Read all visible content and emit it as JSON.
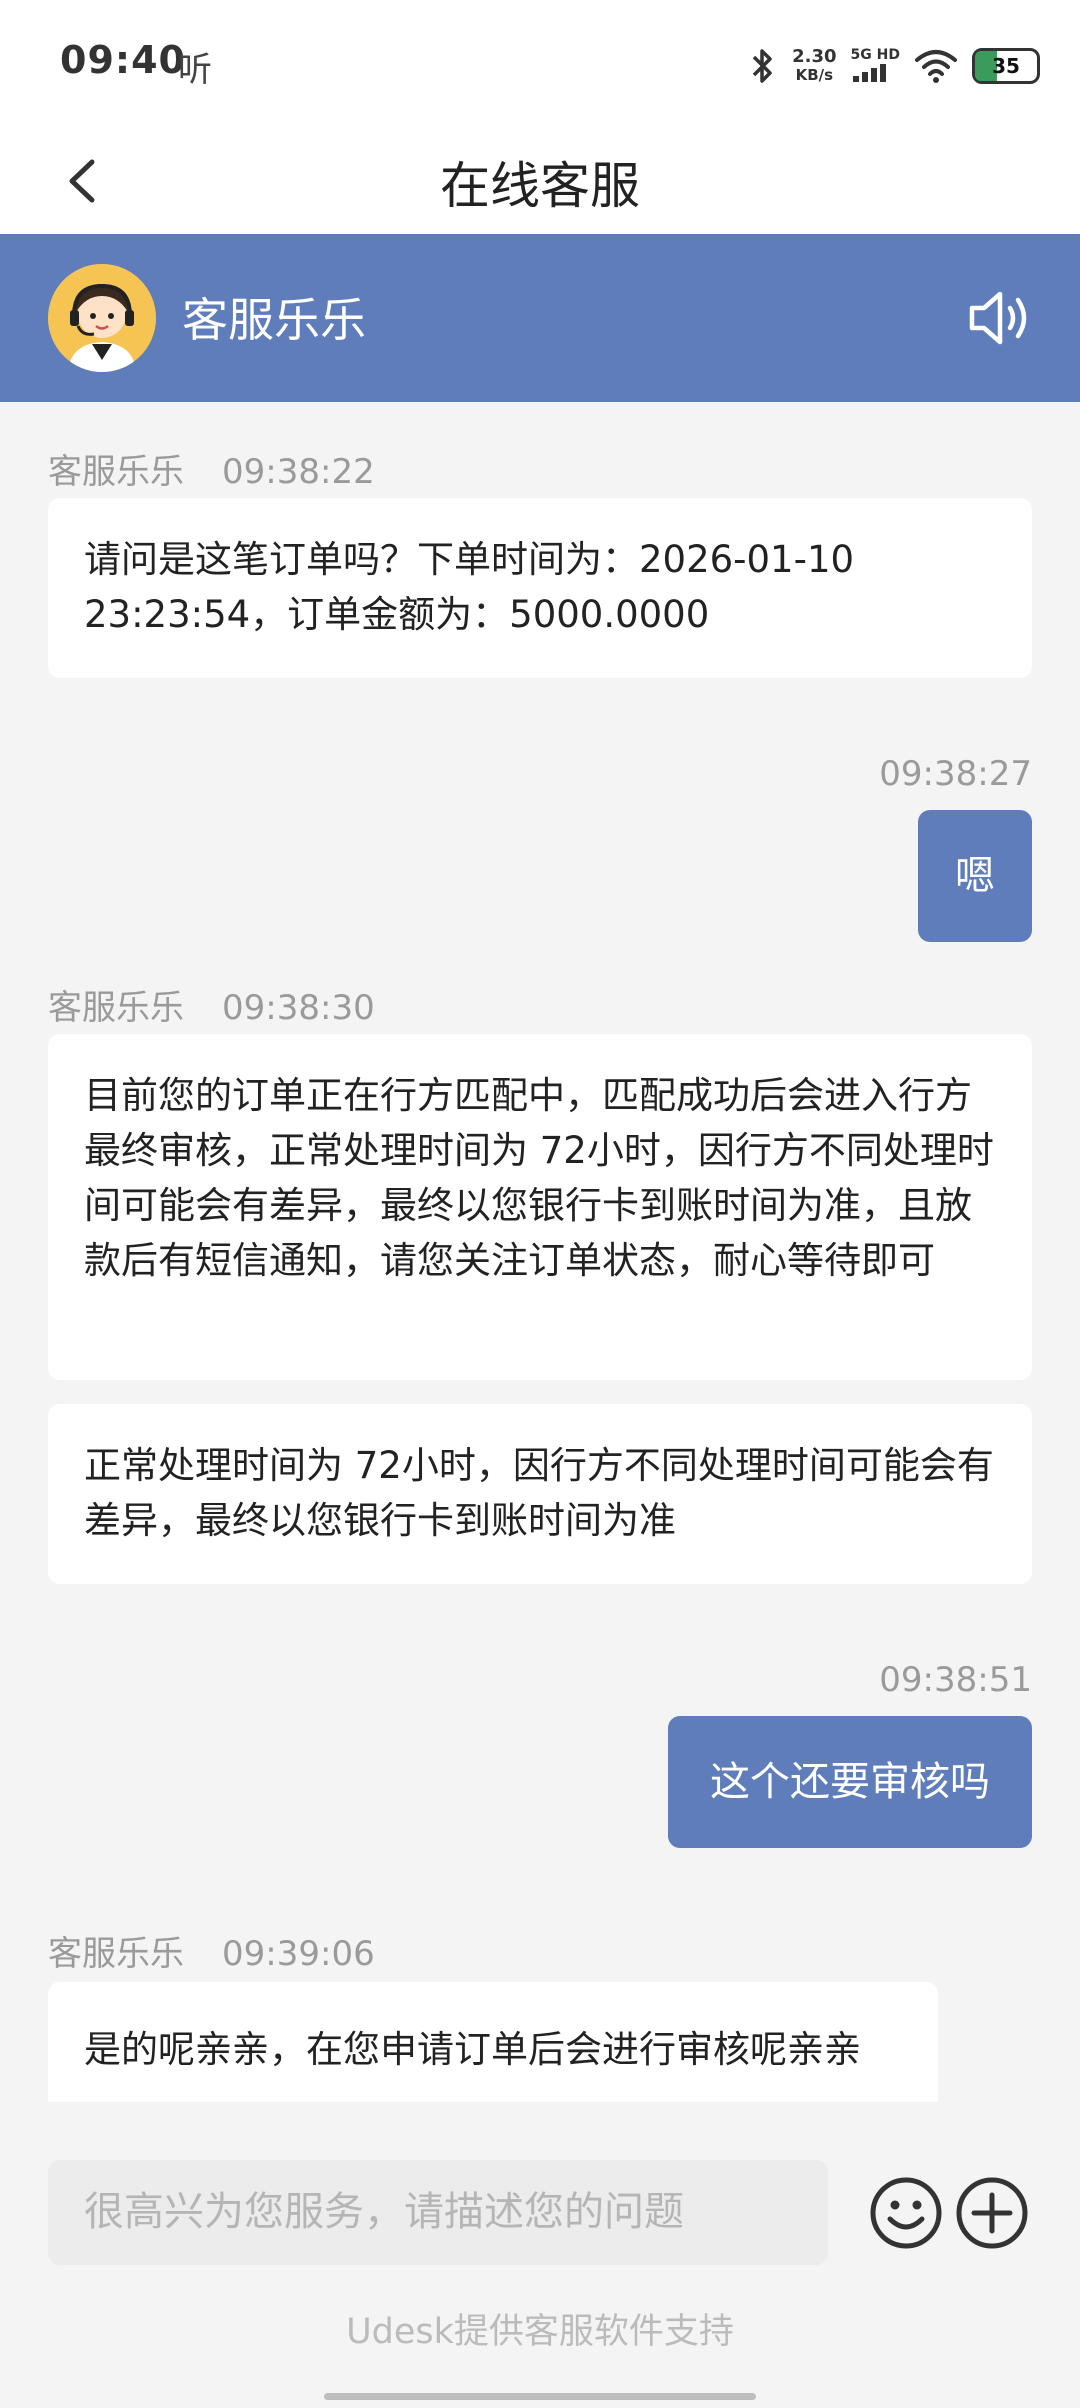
{
  "status_bar": {
    "time": "09:40",
    "carrier_glyph": "听",
    "speed_value": "2.30",
    "speed_unit": "KB/s",
    "network_label": "5G HD",
    "battery_level": "35"
  },
  "nav": {
    "title": "在线客服"
  },
  "agent": {
    "name": "客服乐乐"
  },
  "messages": [
    {
      "sender": "客服乐乐",
      "time": "09:38:22",
      "text": "请问是这笔订单吗？下单时间为：2026-01-10 23:23:54，订单金额为：5000.0000"
    },
    {
      "time": "09:38:27",
      "text": "嗯"
    },
    {
      "sender": "客服乐乐",
      "time": "09:38:30",
      "text": "目前您的订单正在行方匹配中，匹配成功后会进入行方最终审核，正常处理时间为 72小时，因行方不同处理时间可能会有差异，最终以您银行卡到账时间为准，且放款后有短信通知，请您关注订单状态，耐心等待即可"
    },
    {
      "text": "正常处理时间为 72小时，因行方不同处理时间可能会有差异，最终以您银行卡到账时间为准"
    },
    {
      "time": "09:38:51",
      "text": "这个还要审核吗"
    },
    {
      "sender": "客服乐乐",
      "time": "09:39:06",
      "text": "是的呢亲亲，在您申请订单后会进行审核呢亲亲"
    }
  ],
  "composer": {
    "placeholder": "很高兴为您服务，请描述您的问题"
  },
  "footer": {
    "text": "Udesk提供客服软件支持"
  },
  "colors": {
    "accent": "#5f7dba",
    "background": "#f4f4f4"
  },
  "icons": [
    "back-icon",
    "bluetooth-icon",
    "signal-icon",
    "wifi-icon",
    "battery-icon",
    "speaker-icon",
    "emoji-icon",
    "plus-icon"
  ]
}
